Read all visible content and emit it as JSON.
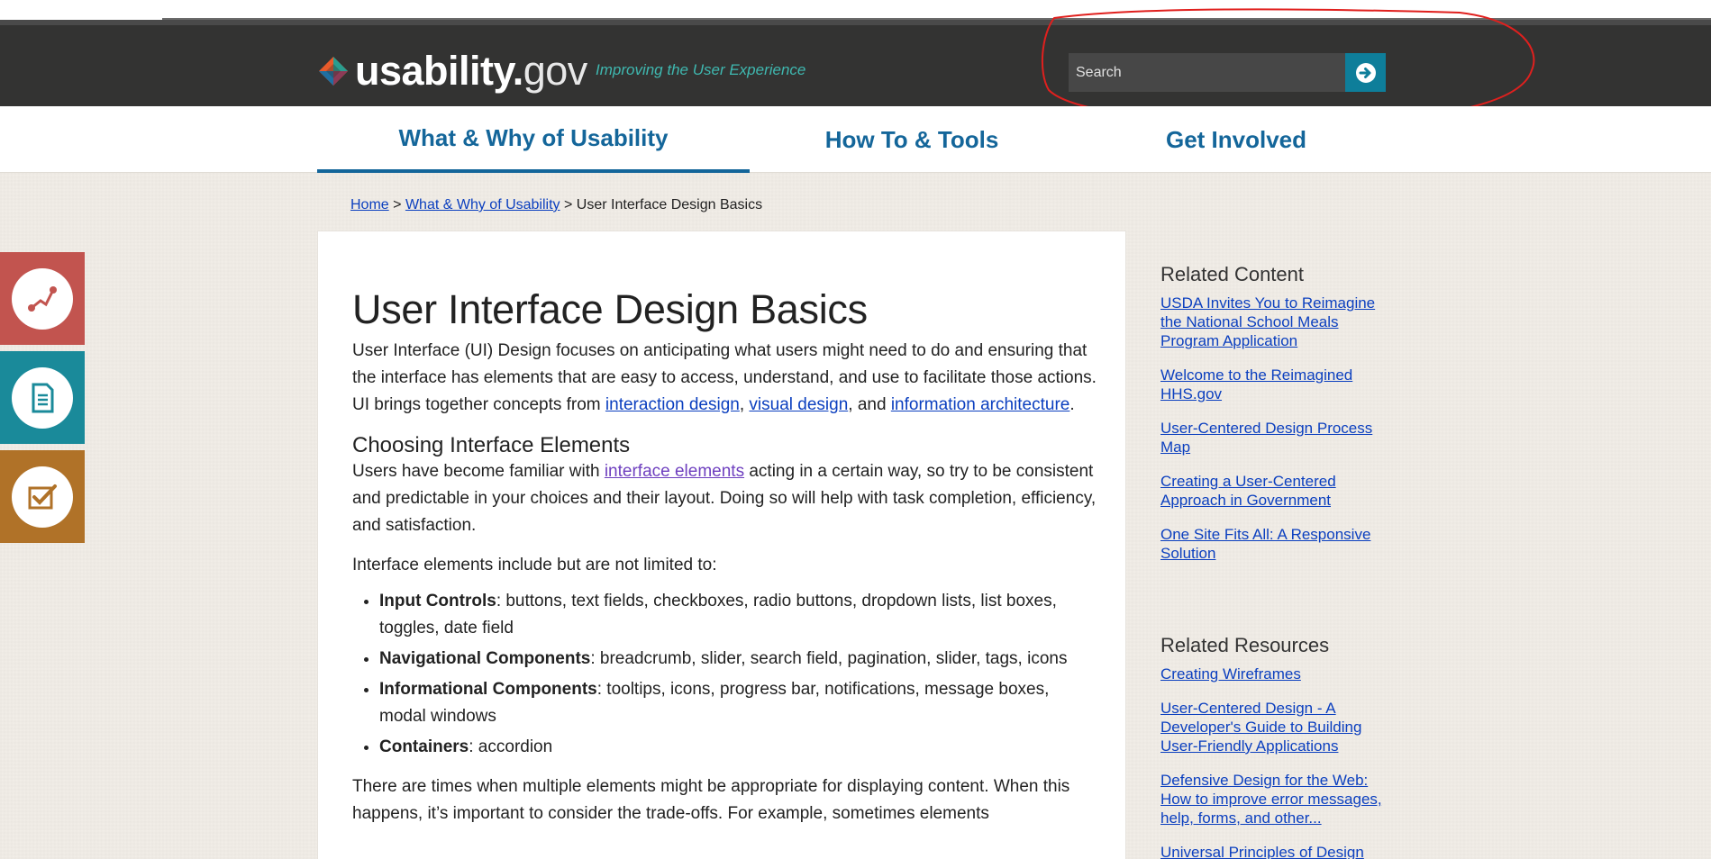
{
  "site": {
    "logo_main": "usability.",
    "logo_gov": "gov",
    "tagline": "Improving the User Experience"
  },
  "search": {
    "placeholder": "Search",
    "button_icon": "arrow-right-circle-icon"
  },
  "nav": {
    "items": [
      {
        "label": "What & Why of Usability",
        "active": true
      },
      {
        "label": "How To & Tools",
        "active": false
      },
      {
        "label": "Get Involved",
        "active": false
      }
    ]
  },
  "breadcrumb": {
    "home": "Home",
    "sep1": ">",
    "section": "What & Why of Usability",
    "sep2": ">",
    "current": "User Interface Design Basics"
  },
  "side_icons": [
    {
      "icon": "route-icon",
      "color": "#c2544f"
    },
    {
      "icon": "document-icon",
      "color": "#1a8a9a"
    },
    {
      "icon": "checklist-icon",
      "color": "#b07228"
    }
  ],
  "article": {
    "title": "User Interface Design Basics",
    "intro_1": "User Interface (UI) Design focuses on anticipating what users might need to do and ensuring that the interface has elements that are easy to access, understand, and use to facilitate those actions. UI brings together concepts from ",
    "intro_link1": "interaction design",
    "intro_sep1": ", ",
    "intro_link2": "visual design",
    "intro_sep2": ", and ",
    "intro_link3": "information architecture",
    "intro_end": ".",
    "section_heading": "Choosing Interface Elements",
    "choose_1": "Users have become familiar with ",
    "choose_link": "interface elements",
    "choose_2": " acting in a certain way, so try to be consistent and predictable in your choices and their layout. Doing so will help with task completion, efficiency, and satisfaction.",
    "list_intro": "Interface elements include but are not limited to:",
    "elements": [
      {
        "term": "Input Controls",
        "desc": ": buttons, text fields, checkboxes, radio buttons, dropdown lists, list boxes, toggles, date field"
      },
      {
        "term": "Navigational Components",
        "desc": ": breadcrumb, slider, search field, pagination, slider, tags, icons"
      },
      {
        "term": "Informational Components",
        "desc": ": tooltips, icons, progress bar, notifications, message boxes, modal windows"
      },
      {
        "term": "Containers",
        "desc": ": accordion"
      }
    ],
    "closing": "There are times when multiple elements might be appropriate for displaying content.  When this happens, it’s important to consider the trade-offs.  For example, sometimes elements"
  },
  "related_content": {
    "heading": "Related Content",
    "links": [
      "USDA Invites You to Reimagine the National School Meals Program Application",
      "Welcome to the Reimagined HHS.gov",
      "User-Centered Design Process Map",
      "Creating a User-Centered Approach in Government",
      "One Site Fits All: A Responsive Solution"
    ]
  },
  "related_resources": {
    "heading": "Related Resources",
    "links": [
      "Creating Wireframes",
      "User-Centered Design - A Developer's Guide to Building User-Friendly Applications",
      "Defensive Design for the Web: How to improve error messages, help, forms, and other...",
      "Universal Principles of Design"
    ]
  },
  "colors": {
    "header_bg": "#333332",
    "accent_teal": "#3fb8b0",
    "nav_blue": "#14669a",
    "search_button": "#0e7e9a",
    "link": "#0b3fbf",
    "annotation_red": "#e0201e"
  }
}
